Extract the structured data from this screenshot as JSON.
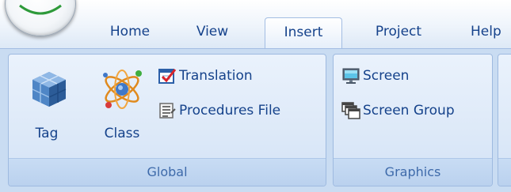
{
  "tabs": [
    {
      "label": "Home"
    },
    {
      "label": "View"
    },
    {
      "label": "Insert",
      "active": true
    },
    {
      "label": "Project"
    },
    {
      "label": "Help"
    }
  ],
  "groups": {
    "global": {
      "label": "Global",
      "buttons": {
        "tag": {
          "label": "Tag",
          "icon": "tag-cube-icon"
        },
        "class": {
          "label": "Class",
          "icon": "atom-icon"
        },
        "translation": {
          "label": "Translation",
          "icon": "translation-checklist-icon"
        },
        "procedures": {
          "label": "Procedures File",
          "icon": "procedures-file-icon"
        }
      }
    },
    "graphics": {
      "label": "Graphics",
      "buttons": {
        "screen": {
          "label": "Screen",
          "icon": "screen-monitor-icon"
        },
        "screen_group": {
          "label": "Screen Group",
          "icon": "screen-group-icon"
        }
      }
    }
  },
  "colors": {
    "text": "#15428b",
    "ribbon_bg": "#c9dcf2",
    "group_label": "#3e6aaa"
  }
}
